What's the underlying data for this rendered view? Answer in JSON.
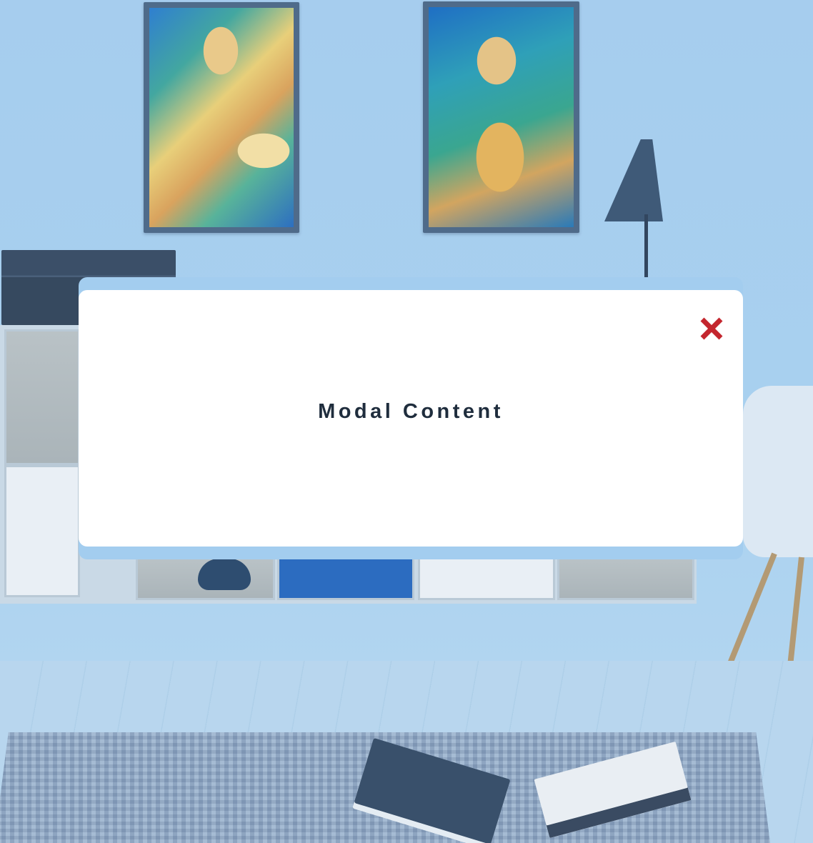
{
  "modal": {
    "content_text": "Modal Content",
    "close_icon": "close-icon",
    "close_color": "#c4262e"
  },
  "background": {
    "description_icon": "room-photo-background"
  }
}
